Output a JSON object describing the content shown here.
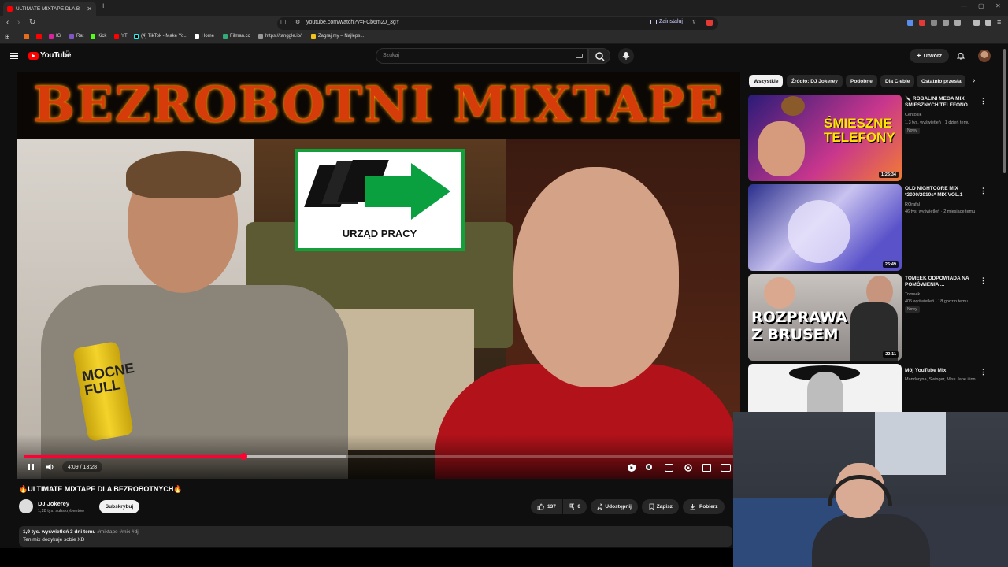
{
  "browser": {
    "tab_title": "ULTIMATE MIXTAPE DLA B",
    "url": "youtube.com/watch?v=FCb6m2J_3gY",
    "install_label": "Zainstaluj",
    "bookmarks": [
      "IG",
      "Rat",
      "Kick",
      "YT",
      "(4) TikTok - Make Yo...",
      "Home",
      "Filman.cc",
      "https://tanggle.io/",
      "Zagraj.my – Najleps..."
    ]
  },
  "header": {
    "logo_text": "YouTube",
    "country_code": "PL",
    "search_placeholder": "Szukaj",
    "create_label": "Utwórz"
  },
  "thumbnail": {
    "banner_text": "BEZROBOTNI MIXTAPE",
    "sign_text": "URZĄD PRACY",
    "can_text": "MOCNE FULL"
  },
  "player": {
    "time": "4:09 / 13:28",
    "progress": 0.309
  },
  "video": {
    "title": "🔥ULTIMATE MIXTAPE DLA BEZROBOTNYCH🔥",
    "channel": "DJ Jokerey",
    "subscribers": "1,28 tys. subskrybentów",
    "subscribe_label": "Subskrybuj",
    "likes": "137",
    "dislikes": "0",
    "share_label": "Udostępnij",
    "save_label": "Zapisz",
    "download_label": "Pobierz",
    "views_date": "1,9 tys. wyświetleń  3 dni temu",
    "tags": "#mixtape #mix #dj",
    "description": "Ten mix dedykuje sobie XD"
  },
  "chips": [
    "Wszystkie",
    "Źródło: DJ Jokerey",
    "Podobne",
    "Dla Ciebie",
    "Ostatnio przesła"
  ],
  "recommendations": [
    {
      "title": "🔪 ROBALINI MEGA MIX ŚMIESZNYCH TELEFONÓ...",
      "channel": "Centosik",
      "meta": "1,3 tys. wyświetleń · 1 dzień temu",
      "badge": "Nowy",
      "duration": "1:25:34",
      "thumb_text": "ŚMIESZNE TELEFONY"
    },
    {
      "title": "OLD NIGHTCORE MIX *2000/2010s* MIX VOL.1",
      "channel": "RQrafal",
      "meta": "46 tys. wyświetleń · 2 miesiące temu",
      "badge": "",
      "duration": "25:49",
      "thumb_text": ""
    },
    {
      "title": "TOMEEK ODPOWIADA NA POMÓWIENIA ...",
      "channel": "Tomeek",
      "meta": "405 wyświetleń · 18 godzin temu",
      "badge": "Nowy",
      "duration": "22:11",
      "thumb_text": "ROZPRAWA Z BRUSEM"
    },
    {
      "title": "Mój YouTube Mix",
      "channel": "Mandaryna, Swinger, Miss Jane i inni",
      "meta": "",
      "badge": "",
      "duration": "",
      "thumb_text": ""
    }
  ],
  "icons": [
    "back-icon",
    "forward-icon",
    "reload-icon",
    "bookmark-star-icon",
    "menu-icon",
    "search-icon",
    "keyboard-icon",
    "mic-icon",
    "plus-icon",
    "bell-icon",
    "pause-icon",
    "volume-icon",
    "like-icon",
    "dislike-icon",
    "share-icon",
    "save-icon",
    "download-icon",
    "more-vert-icon",
    "settings-icon",
    "captions-icon",
    "fullscreen-icon",
    "miniplayer-icon",
    "theater-icon",
    "autoplay-icon"
  ],
  "colors": {
    "accent": "#ff0033",
    "youtube_red": "#ff0000",
    "bg": "#0f0f0f",
    "chip_bg": "#272727"
  }
}
